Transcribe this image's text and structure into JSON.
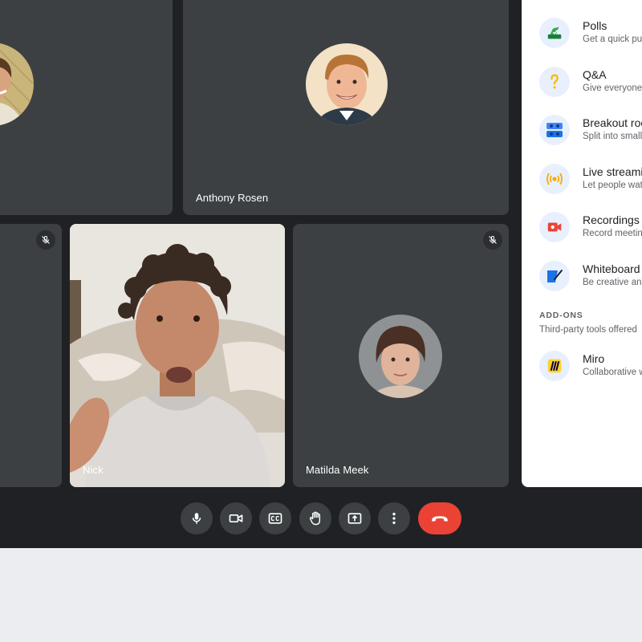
{
  "participants": {
    "top_left": {
      "name": ""
    },
    "top_right": {
      "name": "Anthony Rosen"
    },
    "bottom_center": {
      "name": "Nick"
    },
    "bottom_right": {
      "name": "Matilda Meek"
    }
  },
  "icons": {
    "mute": "mic-off-icon",
    "mic": "mic-icon",
    "camera": "videocam-icon",
    "captions": "closed-caption-icon",
    "raise_hand": "hand-icon",
    "present": "present-screen-icon",
    "more": "more-vert-icon",
    "end_call": "call-end-icon"
  },
  "activities": {
    "items": [
      {
        "title": "Polls",
        "desc": "Get a quick pulse",
        "icon": "polls-icon"
      },
      {
        "title": "Q&A",
        "desc": "Give everyone",
        "icon": "question-icon"
      },
      {
        "title": "Breakout rooms",
        "desc": "Split into small",
        "icon": "breakout-icon"
      },
      {
        "title": "Live streaming",
        "desc": "Let people wat",
        "icon": "live-stream-icon"
      },
      {
        "title": "Recordings",
        "desc": "Record meetin",
        "icon": "record-icon"
      },
      {
        "title": "Whiteboard",
        "desc": "Be creative and",
        "icon": "whiteboard-icon"
      }
    ],
    "addons_title": "ADD-ONS",
    "addons_desc": "Third-party tools offered",
    "addons": [
      {
        "title": "Miro",
        "desc": "Collaborative w",
        "icon": "miro-icon"
      }
    ]
  },
  "colors": {
    "meet_bg": "#202124",
    "tile_bg": "#3c4043",
    "end_call": "#ea4335",
    "panel_bg": "#ffffff",
    "page_bg": "#ecedf0"
  }
}
